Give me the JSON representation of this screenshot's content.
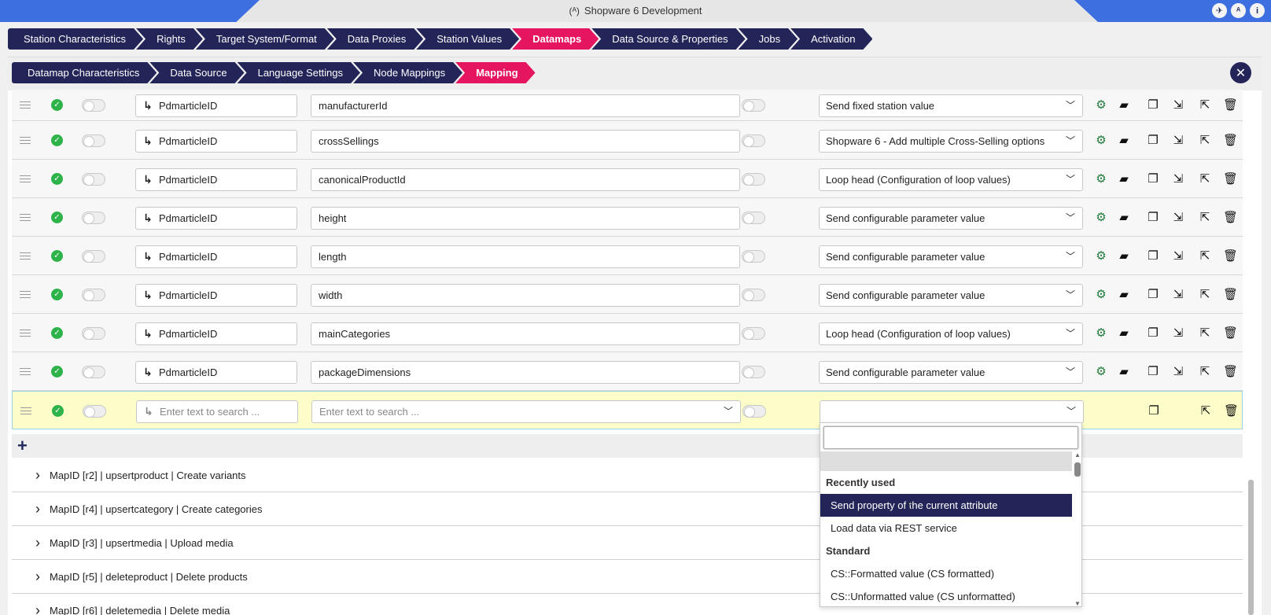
{
  "window": {
    "title": "Shopware 6 Development",
    "title_icon": "antenna-icon"
  },
  "nav_main": [
    {
      "label": "Station Characteristics",
      "active": false
    },
    {
      "label": "Rights",
      "active": false
    },
    {
      "label": "Target System/Format",
      "active": false
    },
    {
      "label": "Data Proxies",
      "active": false
    },
    {
      "label": "Station Values",
      "active": false
    },
    {
      "label": "Datamaps",
      "active": true
    },
    {
      "label": "Data Source & Properties",
      "active": false
    },
    {
      "label": "Jobs",
      "active": false
    },
    {
      "label": "Activation",
      "active": false
    }
  ],
  "nav_sub": [
    {
      "label": "Datamap Characteristics",
      "active": false
    },
    {
      "label": "Data Source",
      "active": false
    },
    {
      "label": "Language Settings",
      "active": false
    },
    {
      "label": "Node Mappings",
      "active": false
    },
    {
      "label": "Mapping",
      "active": true
    }
  ],
  "rows": [
    {
      "source": "PdmarticleID",
      "target": "manufacturerId",
      "method": "Send fixed station value"
    },
    {
      "source": "PdmarticleID",
      "target": "crossSellings",
      "method": "Shopware 6 - Add multiple Cross-Selling options"
    },
    {
      "source": "PdmarticleID",
      "target": "canonicalProductId",
      "method": "Loop head (Configuration of loop values)"
    },
    {
      "source": "PdmarticleID",
      "target": "height",
      "method": "Send configurable parameter value"
    },
    {
      "source": "PdmarticleID",
      "target": "length",
      "method": "Send configurable parameter value"
    },
    {
      "source": "PdmarticleID",
      "target": "width",
      "method": "Send configurable parameter value"
    },
    {
      "source": "PdmarticleID",
      "target": "mainCategories",
      "method": "Loop head (Configuration of loop values)"
    },
    {
      "source": "PdmarticleID",
      "target": "packageDimensions",
      "method": "Send configurable parameter value"
    }
  ],
  "new_row": {
    "source_placeholder": "Enter text to search ...",
    "target_placeholder": "Enter text to search ...",
    "method": ""
  },
  "add_label": "+",
  "maps": [
    "MapID [r2] | upsertproduct | Create variants",
    "MapID [r4] | upsertcategory | Create categories",
    "MapID [r3] | upsertmedia | Upload media",
    "MapID [r5] | deleteproduct | Delete products",
    "MapID [r6] | deletemedia | Delete media"
  ],
  "dropdown": {
    "search_value": "",
    "groups": [
      {
        "label": "Recently used",
        "items": [
          "Send property of the current attribute",
          "Load data via REST service"
        ]
      },
      {
        "label": "Standard",
        "items": [
          "CS::Formatted value (CS formatted)",
          "CS::Unformatted value (CS unformatted)"
        ]
      }
    ],
    "highlighted": "Send property of the current attribute"
  },
  "colors": {
    "nav": "#232559",
    "active": "#e6155f",
    "titlebar_accent": "#3d6fe0",
    "check": "#2db34a",
    "new_row": "#fdfdc9"
  }
}
